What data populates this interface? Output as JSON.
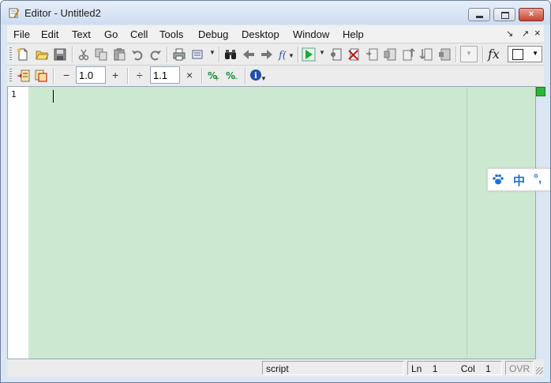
{
  "window": {
    "title": "Editor - Untitled2"
  },
  "menu": {
    "items": [
      "File",
      "Edit",
      "Text",
      "Go",
      "Cell",
      "Tools",
      "Debug",
      "Desktop",
      "Window",
      "Help"
    ],
    "dock_glyph": "↘",
    "undock_glyph": "↗",
    "close_glyph": "×"
  },
  "cell_toolbar": {
    "decrement_label": "−",
    "increment_value": "1.0",
    "increment_plus_label": "+",
    "divide_label": "÷",
    "multiply_value": "1.1",
    "multiply_label": "×"
  },
  "editor": {
    "line_numbers": [
      "1"
    ],
    "content": "",
    "status_color": "#2fb53a"
  },
  "ime": {
    "chinese_label": "中",
    "punct_label": "°,"
  },
  "statusbar": {
    "mode": "script",
    "ln_label": "Ln",
    "ln_value": "1",
    "col_label": "Col",
    "col_value": "1",
    "ovr": "OVR"
  }
}
